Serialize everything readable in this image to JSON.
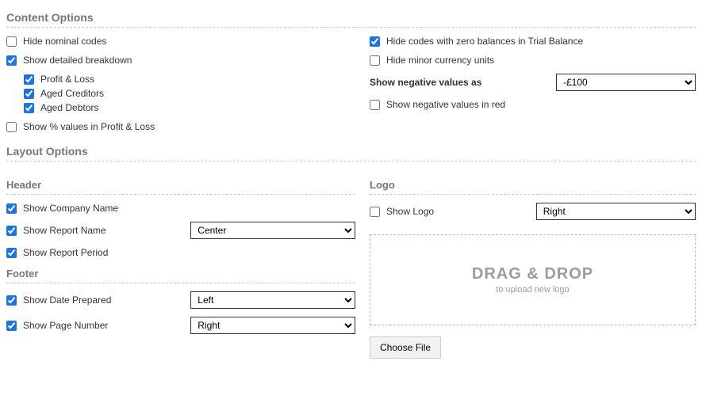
{
  "sections": {
    "content": "Content Options",
    "layout": "Layout Options",
    "header": "Header",
    "footer": "Footer",
    "logo": "Logo"
  },
  "content": {
    "hide_nominal": "Hide nominal codes",
    "show_breakdown": "Show detailed breakdown",
    "pl": "Profit & Loss",
    "creditors": "Aged Creditors",
    "debtors": "Aged Debtors",
    "show_pct": "Show % values in Profit & Loss",
    "hide_zero": "Hide codes with zero balances in Trial Balance",
    "hide_minor": "Hide minor currency units",
    "neg_label": "Show negative values as",
    "neg_value": "-£100",
    "neg_red": "Show negative values in red"
  },
  "header": {
    "company": "Show Company Name",
    "report_name": "Show Report Name",
    "report_name_pos": "Center",
    "period": "Show Report Period"
  },
  "footer": {
    "date_prepared": "Show Date Prepared",
    "date_pos": "Left",
    "page_number": "Show Page Number",
    "page_pos": "Right"
  },
  "logo": {
    "show": "Show Logo",
    "pos": "Right",
    "drop_big": "DRAG & DROP",
    "drop_small": "to upload new logo",
    "choose": "Choose File"
  }
}
